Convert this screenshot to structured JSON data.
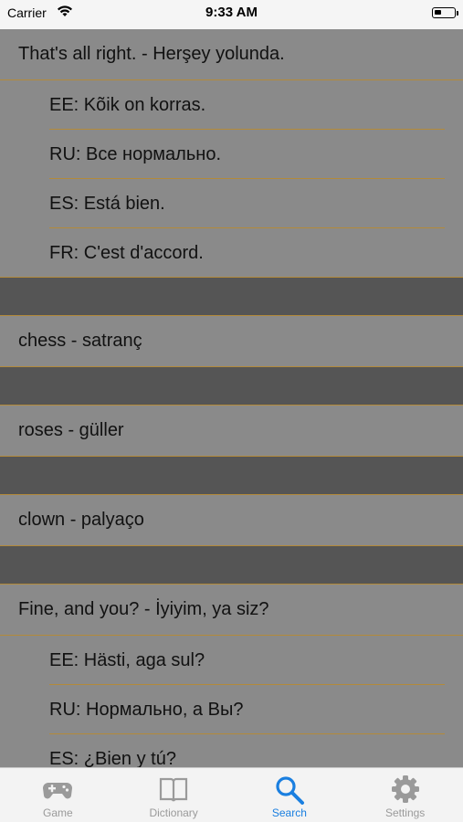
{
  "status": {
    "carrier": "Carrier",
    "time": "9:33 AM"
  },
  "entries": [
    {
      "phrase": "That's all right. - Herşey yolunda.",
      "translations": [
        "EE: Kõik on korras.",
        "RU: Все нормально.",
        "ES: Está bien.",
        "FR: C'est d'accord."
      ]
    },
    {
      "phrase": "chess - satranç",
      "translations": []
    },
    {
      "phrase": "roses - güller",
      "translations": []
    },
    {
      "phrase": "clown - palyaço",
      "translations": []
    },
    {
      "phrase": "Fine, and you? - İyiyim, ya siz?",
      "translations": [
        "EE: Hästi, aga sul?",
        "RU: Нормально, а Вы?",
        "ES: ¿Bien y tú?"
      ]
    }
  ],
  "tabs": [
    {
      "label": "Game",
      "icon": "gamepad-icon",
      "active": false
    },
    {
      "label": "Dictionary",
      "icon": "book-icon",
      "active": false
    },
    {
      "label": "Search",
      "icon": "search-icon",
      "active": true
    },
    {
      "label": "Settings",
      "icon": "gear-icon",
      "active": false
    }
  ],
  "colors": {
    "accent": "#1a7fe0",
    "separator": "#b38a3a",
    "row_bg": "#8a8a8a",
    "gap_bg": "#555555"
  }
}
